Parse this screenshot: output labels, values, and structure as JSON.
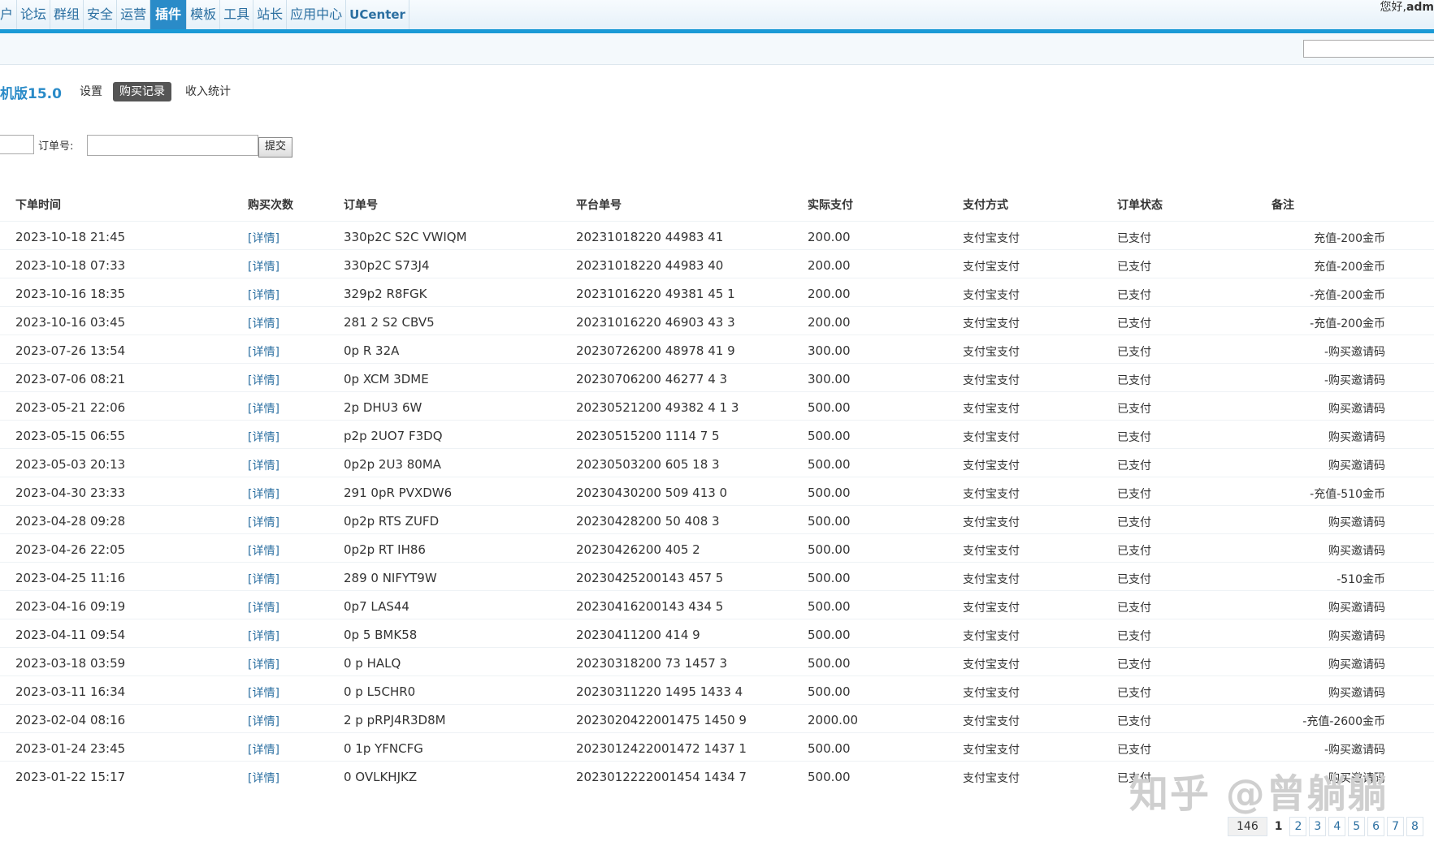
{
  "topnav": {
    "items": [
      "户",
      "论坛",
      "群组",
      "安全",
      "运营",
      "插件",
      "模板",
      "工具",
      "站长",
      "应用中心",
      "UCenter"
    ],
    "active_index": 5,
    "greeting": "您好,",
    "username": "adm"
  },
  "plugin": {
    "title": "机版15.0",
    "tabs": [
      "设置",
      "购买记录",
      "收入统计"
    ],
    "active_tab_index": 1
  },
  "search": {
    "order_label": "订单号:",
    "order_value": "",
    "submit_label": "提交"
  },
  "table": {
    "headers": [
      "下单时间",
      "购买次数",
      "订单号",
      "平台单号",
      "实际支付",
      "支付方式",
      "订单状态",
      "备注"
    ],
    "rows": [
      {
        "time": "2023-10-18 21:45",
        "detail": "[详情]",
        "order": "330p2C S2C VWIQM",
        "platform": "20231018220 44983 41",
        "amount": "200.00",
        "method": "支付宝支付",
        "status": "已支付",
        "remark": "充值-200金币"
      },
      {
        "time": "2023-10-18 07:33",
        "detail": "[详情]",
        "order": "330p2C S73J4",
        "platform": "20231018220 44983 40",
        "amount": "200.00",
        "method": "支付宝支付",
        "status": "已支付",
        "remark": "充值-200金币"
      },
      {
        "time": "2023-10-16 18:35",
        "detail": "[详情]",
        "order": "329p2 R8FGK",
        "platform": "20231016220 49381 45 1",
        "amount": "200.00",
        "method": "支付宝支付",
        "status": "已支付",
        "remark": "-充值-200金币"
      },
      {
        "time": "2023-10-16 03:45",
        "detail": "[详情]",
        "order": "281 2 S2 CBV5",
        "platform": "20231016220 46903 43 3",
        "amount": "200.00",
        "method": "支付宝支付",
        "status": "已支付",
        "remark": "-充值-200金币"
      },
      {
        "time": "2023-07-26 13:54",
        "detail": "[详情]",
        "order": "0p R 32A",
        "platform": "20230726200 48978 41 9",
        "amount": "300.00",
        "method": "支付宝支付",
        "status": "已支付",
        "remark": "-购买邀请码"
      },
      {
        "time": "2023-07-06 08:21",
        "detail": "[详情]",
        "order": "0p XCM 3DME",
        "platform": "20230706200 46277 4 3",
        "amount": "300.00",
        "method": "支付宝支付",
        "status": "已支付",
        "remark": "-购买邀请码"
      },
      {
        "time": "2023-05-21 22:06",
        "detail": "[详情]",
        "order": "2p DHU3 6W",
        "platform": "20230521200 49382 4 1 3",
        "amount": "500.00",
        "method": "支付宝支付",
        "status": "已支付",
        "remark": "购买邀请码"
      },
      {
        "time": "2023-05-15 06:55",
        "detail": "[详情]",
        "order": "p2p 2UO7 F3DQ",
        "platform": "20230515200 1114 7 5",
        "amount": "500.00",
        "method": "支付宝支付",
        "status": "已支付",
        "remark": "购买邀请码"
      },
      {
        "time": "2023-05-03 20:13",
        "detail": "[详情]",
        "order": "0p2p 2U3 80MA",
        "platform": "20230503200 605 18 3",
        "amount": "500.00",
        "method": "支付宝支付",
        "status": "已支付",
        "remark": "购买邀请码"
      },
      {
        "time": "2023-04-30 23:33",
        "detail": "[详情]",
        "order": "291 0pR PVXDW6",
        "platform": "20230430200 509 413 0",
        "amount": "500.00",
        "method": "支付宝支付",
        "status": "已支付",
        "remark": "-充值-510金币"
      },
      {
        "time": "2023-04-28 09:28",
        "detail": "[详情]",
        "order": "0p2p RTS ZUFD",
        "platform": "20230428200 50 408 3",
        "amount": "500.00",
        "method": "支付宝支付",
        "status": "已支付",
        "remark": "购买邀请码"
      },
      {
        "time": "2023-04-26 22:05",
        "detail": "[详情]",
        "order": "0p2p RT IH86",
        "platform": "20230426200 405 2",
        "amount": "500.00",
        "method": "支付宝支付",
        "status": "已支付",
        "remark": "购买邀请码"
      },
      {
        "time": "2023-04-25 11:16",
        "detail": "[详情]",
        "order": "289 0 NIFYT9W",
        "platform": "20230425200143 457 5",
        "amount": "500.00",
        "method": "支付宝支付",
        "status": "已支付",
        "remark": "-510金币"
      },
      {
        "time": "2023-04-16 09:19",
        "detail": "[详情]",
        "order": "0p7 LAS44",
        "platform": "20230416200143 434 5",
        "amount": "500.00",
        "method": "支付宝支付",
        "status": "已支付",
        "remark": "购买邀请码"
      },
      {
        "time": "2023-04-11 09:54",
        "detail": "[详情]",
        "order": "0p 5 BMK58",
        "platform": "20230411200 414 9",
        "amount": "500.00",
        "method": "支付宝支付",
        "status": "已支付",
        "remark": "购买邀请码"
      },
      {
        "time": "2023-03-18 03:59",
        "detail": "[详情]",
        "order": "0 p HALQ",
        "platform": "20230318200 73 1457 3",
        "amount": "500.00",
        "method": "支付宝支付",
        "status": "已支付",
        "remark": "购买邀请码"
      },
      {
        "time": "2023-03-11 16:34",
        "detail": "[详情]",
        "order": "0 p L5CHR0",
        "platform": "20230311220 1495 1433 4",
        "amount": "500.00",
        "method": "支付宝支付",
        "status": "已支付",
        "remark": "购买邀请码"
      },
      {
        "time": "2023-02-04 08:16",
        "detail": "[详情]",
        "order": "2 p pRPJ4R3D8M",
        "platform": "2023020422001475 1450 9",
        "amount": "2000.00",
        "method": "支付宝支付",
        "status": "已支付",
        "remark": "-充值-2600金币"
      },
      {
        "time": "2023-01-24 23:45",
        "detail": "[详情]",
        "order": "0 1p YFNCFG",
        "platform": "2023012422001472 1437 1",
        "amount": "500.00",
        "method": "支付宝支付",
        "status": "已支付",
        "remark": "-购买邀请码"
      },
      {
        "time": "2023-01-22 15:17",
        "detail": "[详情]",
        "order": "0 OVLKHJKZ",
        "platform": "2023012222001454 1434 7",
        "amount": "500.00",
        "method": "支付宝支付",
        "status": "已支付",
        "remark": "购买邀请码"
      }
    ]
  },
  "pagination": {
    "total": "146",
    "current": "1",
    "pages": [
      "2",
      "3",
      "4",
      "5",
      "6",
      "7",
      "8"
    ]
  },
  "watermark": "知乎 @曾躺躺"
}
